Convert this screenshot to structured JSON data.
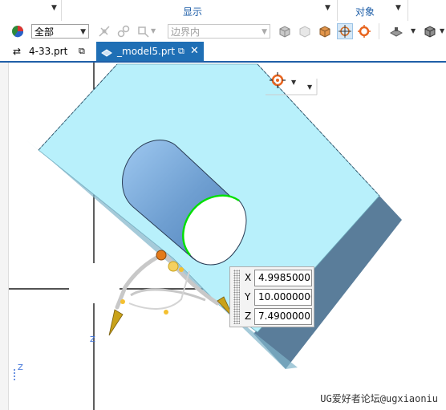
{
  "ribbon": {
    "groups": [
      {
        "label": "显示"
      },
      {
        "label": "对象"
      }
    ]
  },
  "toolbar": {
    "type_filter": "全部",
    "scope_filter": "边界内"
  },
  "tabs": [
    {
      "label": "4-33.prt",
      "active": false
    },
    {
      "label": "_model5.prt",
      "active": true
    }
  ],
  "point_dialog": {
    "fields": [
      {
        "axis": "X",
        "value": "4.9985000"
      },
      {
        "axis": "Y",
        "value": "10.0000000"
      },
      {
        "axis": "Z",
        "value": "7.4900000"
      }
    ]
  },
  "triad": {
    "z_label": "Z"
  },
  "wcs": {
    "z_label": "Z"
  },
  "watermark": "UG爱好者论坛@ugxiaoniu",
  "colors": {
    "accent": "#1f6fb5",
    "part_face": "#b8f0fb",
    "part_side": "#5a7d9a",
    "hole_edge_highlight": "#00e000"
  }
}
